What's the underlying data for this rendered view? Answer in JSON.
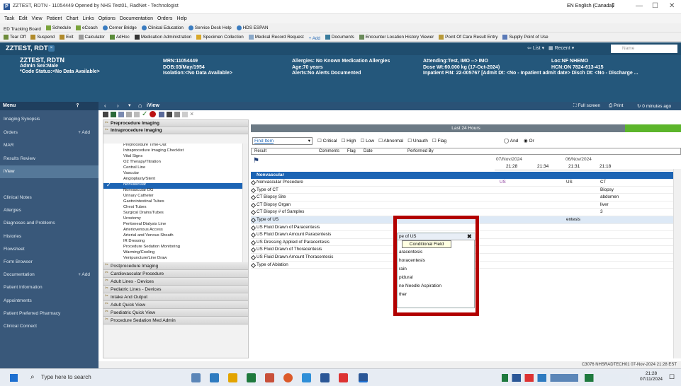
{
  "window": {
    "title": "ZZTEST, RDTN - 11054449 Opened by NHS Test01, RadNet - Technologist",
    "language": "EN English (Canada)"
  },
  "menubar": [
    "Task",
    "Edit",
    "View",
    "Patient",
    "Chart",
    "Links",
    "Options",
    "Documentation",
    "Orders",
    "Help"
  ],
  "toolbar1": [
    "ED Tracking Board",
    "Schedule",
    "eCoach",
    "Cerner Bridge",
    "Clinical Education",
    "Service Desk Help",
    "HDS ESPAN"
  ],
  "toolbar2": [
    "Tear Off",
    "Suspend",
    "Exit",
    "Calculator",
    "AdHoc",
    "Medication Administration",
    "Specimen Collection",
    "Medical Record Request",
    "+ Add",
    "Documents",
    "Encounter Location History Viewer",
    "Point Of Care Result Entry",
    "Supply Point of Use"
  ],
  "banner": {
    "tab": "ZZTEST, RDTN",
    "list": "List",
    "recent": "Recent",
    "search_placeholder": "Name",
    "name": "ZZTEST, RDTN",
    "sex": "Admin Sex:Male",
    "code_status": "*Code Status:<No Data Available>",
    "mrn": "MRN:11054449",
    "dob": "DOB:03/May/1954",
    "isolation": "Isolation:<No Data Available>",
    "allergies": "Allergies: No Known Medication Allergies",
    "age": "Age:70 years",
    "alerts": "Alerts:No Alerts Documented",
    "attending": "Attending:Test, IMO --> IMO",
    "dose_wt": "Dose Wt:60.000 kg (17-Oct-2024)",
    "inpatient": "Inpatient FIN: 22-005767 [Admit Dt: <No - Inpatient admit date> Disch Dt: <No - Discharge ...",
    "loc": "Loc:NF NHEMO",
    "hcn": "HCN:ON 7824-613-415"
  },
  "sidebar": {
    "menu_label": "Menu",
    "items": [
      {
        "label": "Imaging Synopsis",
        "add": ""
      },
      {
        "label": "Orders",
        "add": "+ Add"
      },
      {
        "label": "MAR",
        "add": ""
      },
      {
        "label": "Results Review",
        "add": ""
      },
      {
        "label": "iView",
        "add": ""
      },
      {
        "label": "",
        "add": ""
      },
      {
        "label": "Clinical Notes",
        "add": ""
      },
      {
        "label": "Allergies",
        "add": ""
      },
      {
        "label": "Diagnoses and Problems",
        "add": ""
      },
      {
        "label": "Histories",
        "add": ""
      },
      {
        "label": "Flowsheet",
        "add": ""
      },
      {
        "label": "Form Browser",
        "add": ""
      },
      {
        "label": "Documentation",
        "add": "+ Add"
      },
      {
        "label": "Patient Information",
        "add": ""
      },
      {
        "label": "Appointments",
        "add": ""
      },
      {
        "label": "Patient Preferred Pharmacy",
        "add": ""
      },
      {
        "label": "Clinical Connect",
        "add": ""
      }
    ]
  },
  "content": {
    "page_title": "iView",
    "full_screen": "Full screen",
    "print": "Print",
    "refresh": "0 minutes ago"
  },
  "bands": {
    "top": [
      "Preprocedure Imaging",
      "Intraprocedure Imaging"
    ],
    "sections": [
      "Preprocedure Time-Out",
      "Intraprocedure Imaging Checklist",
      "Vital Signs",
      "O2 Therapy/Titration",
      "Central Line",
      "Vascular",
      "Angioplasty/Stent",
      "Nonvascular",
      "Nonvascular DG",
      "Urinary Catheter",
      "Gastrointestinal Tubes",
      "Chest Tubes",
      "Surgical Drains/Tubes",
      "Urostomy",
      "Peritoneal Dialysis Line",
      "Arteriovenous Access",
      "Arterial and Venous Sheath",
      "IR Dressing",
      "Procedure Sedation Monitoring",
      "Warming/Cooling",
      "Venipuncture/Line Draw"
    ],
    "bottom": [
      "Postprocedure Imaging",
      "Cardiovascular Procedure",
      "Adult Lines - Devices",
      "Pediatric Lines - Devices",
      "Intake And Output",
      "Adult Quick View",
      "Paediatric Quick View",
      "Procedure Sedation Med Admin"
    ]
  },
  "grid": {
    "period": "Last 24 Hours",
    "find_item": "Find Item",
    "filters": [
      "Critical",
      "High",
      "Low",
      "Abnormal",
      "Unauth",
      "Flag"
    ],
    "and": "And",
    "or": "Or",
    "columns": [
      "Result",
      "Comments",
      "Flag",
      "Date",
      "Performed By"
    ],
    "dates": [
      "07/Nov/2024",
      "06/Nov/2024"
    ],
    "times": [
      "21:28",
      "21:34",
      "21:31",
      "21:18"
    ],
    "section": "Nonvascular",
    "rows": [
      {
        "label": "Nonvascular Procedure",
        "v1": "US",
        "v2": "",
        "v3": "US",
        "v4": "CT"
      },
      {
        "label": "Type of CT",
        "v1": "",
        "v2": "",
        "v3": "",
        "v4": "Biopsy"
      },
      {
        "label": "CT Biopsy Site",
        "v1": "",
        "v2": "",
        "v3": "",
        "v4": "abdomen"
      },
      {
        "label": "CT Biopsy Organ",
        "v1": "",
        "v2": "",
        "v3": "",
        "v4": "liver"
      },
      {
        "label": "CT Biopsy # of Samples",
        "v1": "",
        "v2": "",
        "v3": "",
        "v4": "3"
      },
      {
        "label": "Type of US",
        "v1": "",
        "v2": "",
        "v3": "entesis",
        "v4": ""
      },
      {
        "label": "US Fluid Drawn of Paracentesis",
        "v1": "",
        "v2": "",
        "v3": "",
        "v4": ""
      },
      {
        "label": "US Fluid Drawn Amount Paracentesis",
        "v1": "",
        "v2": "",
        "v3": "",
        "v4": ""
      },
      {
        "label": "US Dressing Applied of Paracentesis",
        "v1": "",
        "v2": "",
        "v3": "",
        "v4": ""
      },
      {
        "label": "US Fluid Drawn of Thoracentesis",
        "v1": "",
        "v2": "",
        "v3": "",
        "v4": ""
      },
      {
        "label": "US Fluid Drawn Amount Thoracentesis",
        "v1": "",
        "v2": "",
        "v3": "",
        "v4": ""
      },
      {
        "label": "Type of Ablation",
        "v1": "",
        "v2": "",
        "v3": "",
        "v4": ""
      }
    ]
  },
  "popup": {
    "tooltip": "Conditional Field",
    "partial_value": "pe of US",
    "options": [
      "aracentesis",
      "horacentesis",
      "rain",
      "pidural",
      "ne Needle Aspiration",
      "ther"
    ]
  },
  "status": "C3076  NHSRADTECH01  07-Nov-2024  21:28 EST",
  "taskbar": {
    "search": "Type here to search",
    "time": "21:28",
    "date": "07/11/2024"
  },
  "colors": {
    "banner": "#24577b",
    "sidebar": "#39587a",
    "highlight": "#b20000",
    "selection": "#1c64b4"
  }
}
